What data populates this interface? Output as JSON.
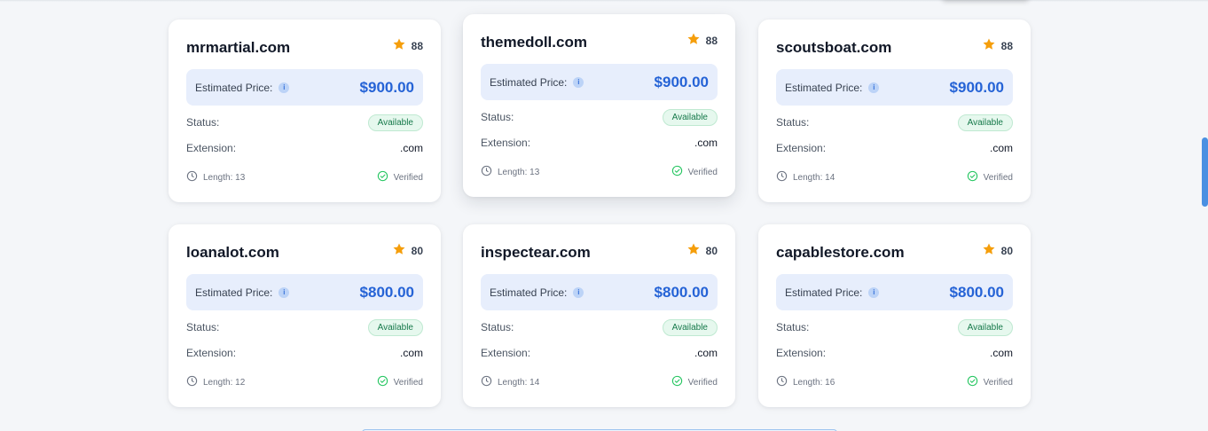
{
  "cards": [
    {
      "domain": "mrmartial.com",
      "score": "88",
      "price_label": "Estimated Price:",
      "price": "$900.00",
      "status_label": "Status:",
      "status": "Available",
      "extension_label": "Extension:",
      "extension": ".com",
      "length": "Length: 13",
      "verified": "Verified"
    },
    {
      "domain": "themedoll.com",
      "score": "88",
      "price_label": "Estimated Price:",
      "price": "$900.00",
      "status_label": "Status:",
      "status": "Available",
      "extension_label": "Extension:",
      "extension": ".com",
      "length": "Length: 13",
      "verified": "Verified"
    },
    {
      "domain": "scoutsboat.com",
      "score": "88",
      "price_label": "Estimated Price:",
      "price": "$900.00",
      "status_label": "Status:",
      "status": "Available",
      "extension_label": "Extension:",
      "extension": ".com",
      "length": "Length: 14",
      "verified": "Verified"
    },
    {
      "domain": "loanalot.com",
      "score": "80",
      "price_label": "Estimated Price:",
      "price": "$800.00",
      "status_label": "Status:",
      "status": "Available",
      "extension_label": "Extension:",
      "extension": ".com",
      "length": "Length: 12",
      "verified": "Verified"
    },
    {
      "domain": "inspectear.com",
      "score": "80",
      "price_label": "Estimated Price:",
      "price": "$800.00",
      "status_label": "Status:",
      "status": "Available",
      "extension_label": "Extension:",
      "extension": ".com",
      "length": "Length: 14",
      "verified": "Verified"
    },
    {
      "domain": "capablestore.com",
      "score": "80",
      "price_label": "Estimated Price:",
      "price": "$800.00",
      "status_label": "Status:",
      "status": "Available",
      "extension_label": "Extension:",
      "extension": ".com",
      "length": "Length: 16",
      "verified": "Verified"
    }
  ],
  "icons": {
    "score": "star-icon",
    "price_info": "info-icon",
    "length": "clock-icon",
    "verified": "check-circle-icon"
  },
  "colors": {
    "accent": "#2563d6",
    "star": "#f59e0b",
    "available_bg": "#e6f8ee",
    "available_text": "#16794a",
    "verified": "#22c55e"
  }
}
